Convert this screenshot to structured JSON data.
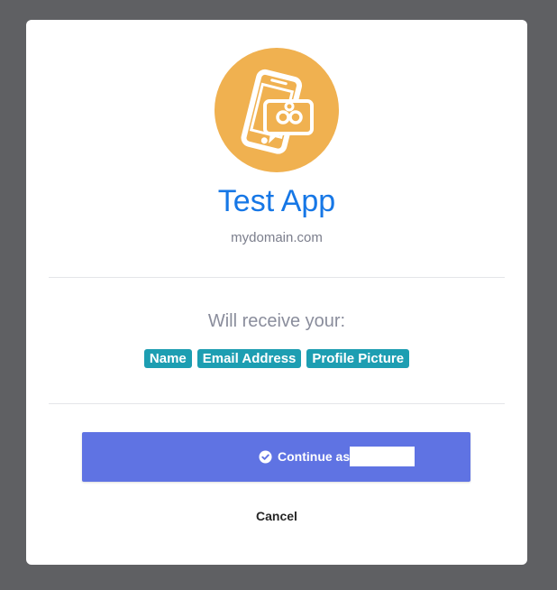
{
  "app": {
    "name": "Test App",
    "domain": "mydomain.com",
    "logo_icon": "phone-chat-icon",
    "logo_color": "#f0b150"
  },
  "consent": {
    "receive_label": "Will receive your:",
    "scopes": [
      "Name",
      "Email Address",
      "Profile Picture"
    ]
  },
  "actions": {
    "continue_label": "Continue as",
    "continue_icon": "check-circle-icon",
    "cancel_label": "Cancel"
  },
  "colors": {
    "title": "#1677e6",
    "scope_badge": "#1d9eb2",
    "continue_button": "#5f73e3",
    "backdrop": "#5f6063"
  }
}
